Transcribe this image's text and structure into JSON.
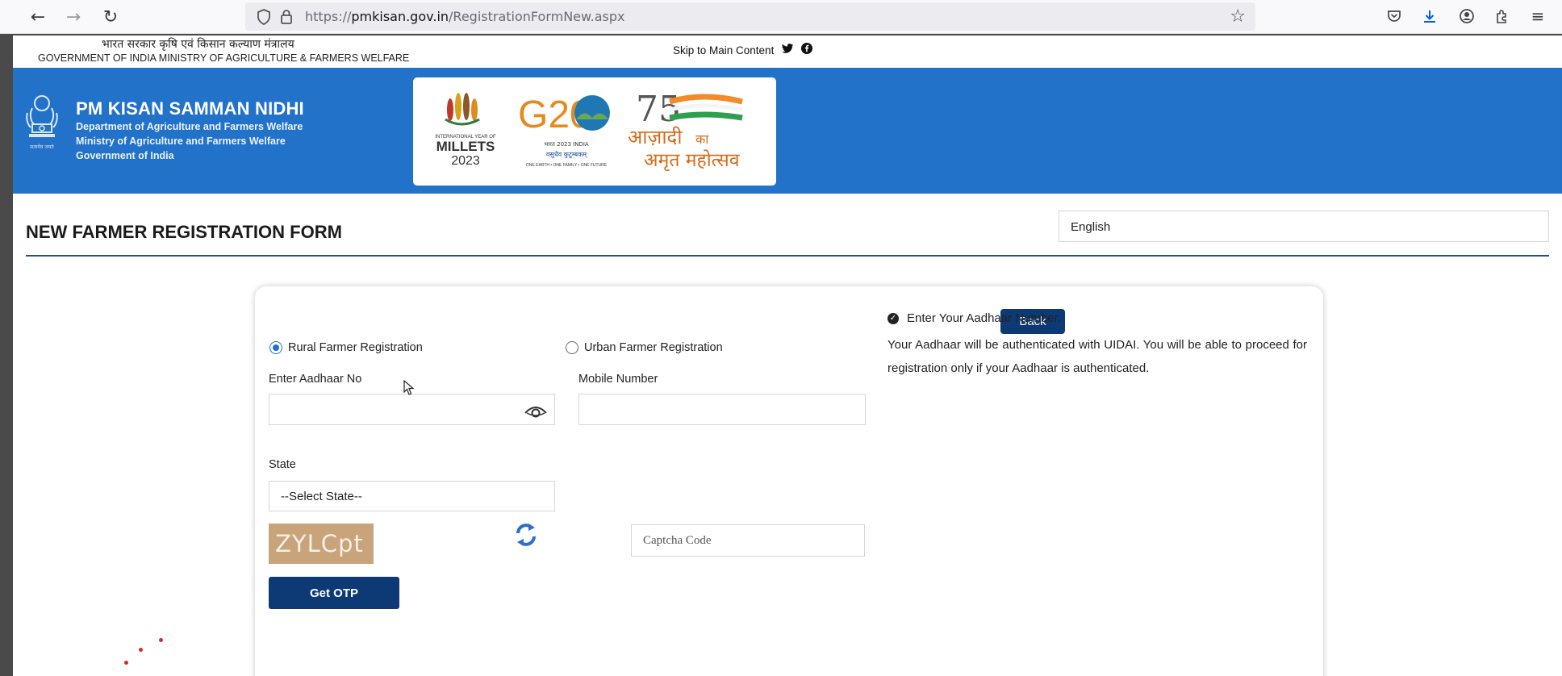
{
  "browser": {
    "url_prefix": "https://",
    "url_host": "pmkisan.gov.in",
    "url_path": "/RegistrationFormNew.aspx",
    "accent": "#0060df"
  },
  "gov_strip": {
    "hindi": "भारत सरकार  कृषि एवं किसान कल्याण मंत्रालय",
    "english": "GOVERNMENT OF INDIA   MINISTRY OF AGRICULTURE & FARMERS WELFARE",
    "skip_link": "Skip to Main Content"
  },
  "header": {
    "title": "PM KISAN SAMMAN NIDHI",
    "lines": [
      "Department of Agriculture and Farmers Welfare",
      "Ministry of Agriculture and Farmers Welfare",
      "Government of India"
    ],
    "emblem_caption": "सत्यमेव जयते",
    "bg_color": "#2372c9",
    "logos": {
      "millets_small": "INTERNATIONAL YEAR OF",
      "millets_big": "MILLETS",
      "millets_year": "2023",
      "g20": "G20",
      "g20_sub": "भारत 2023 INDIA",
      "g20_hindi": "वसुधैव कुटुम्बकम्",
      "g20_motto": "ONE EARTH • ONE FAMILY • ONE FUTURE",
      "azadi_num": "75",
      "azadi_line1": "आज़ादी",
      "azadi_ka": "का",
      "azadi_line2": "अमृत महोत्सव"
    }
  },
  "form": {
    "title": "NEW FARMER REGISTRATION FORM",
    "language": "English",
    "back_label": "Back",
    "rural_label": "Rural Farmer Registration",
    "urban_label": "Urban Farmer Registration",
    "aadhaar_label": "Enter Aadhaar No",
    "mobile_label": "Mobile Number",
    "state_label": "State",
    "state_value": "--Select State--",
    "captcha_text": "ZYLCpt",
    "captcha_placeholder": "Captcha Code",
    "otp_label": "Get OTP",
    "info_heading": "Enter Your Aadhaar Number.",
    "info_body": "Your Aadhaar will be authenticated with UIDAI. You will be able to proceed for registration only if your Aadhaar is authenticated.",
    "button_color": "#0d3a75"
  }
}
